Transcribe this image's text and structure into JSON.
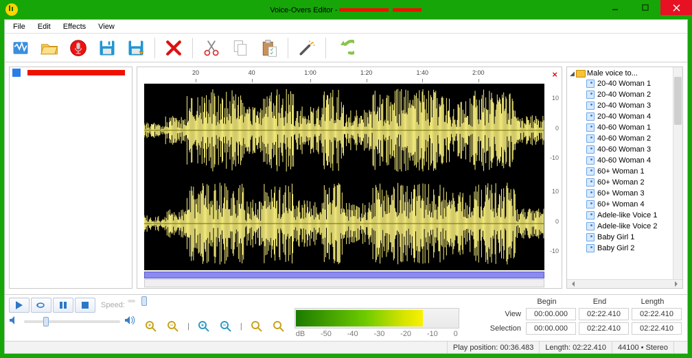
{
  "titlebar": {
    "title_prefix": "Voice-Overs Editor - "
  },
  "menu": {
    "file": "File",
    "edit": "Edit",
    "effects": "Effects",
    "view": "View"
  },
  "ruler": {
    "t0": "20",
    "t1": "40",
    "t2": "1:00",
    "t3": "1:20",
    "t4": "1:40",
    "t5": "2:00"
  },
  "amp": {
    "p10": "10",
    "p0": "0",
    "m10": "-10",
    "p10b": "10",
    "p0b": "0",
    "m10b": "-10"
  },
  "tree": {
    "root": "Male voice to...",
    "items": [
      "20-40 Woman 1",
      "20-40 Woman 2",
      "20-40 Woman 3",
      "20-40 Woman 4",
      "40-60 Woman 1",
      "40-60 Woman 2",
      "40-60 Woman 3",
      "40-60 Woman 4",
      "60+ Woman 1",
      "60+ Woman 2",
      "60+ Woman 3",
      "60+ Woman 4",
      "Adele-like Voice 1",
      "Adele-like Voice 2",
      "Baby Girl 1",
      "Baby Girl 2"
    ]
  },
  "speed_label": "Speed:",
  "meter": {
    "labels": [
      "dB",
      "-50",
      "-40",
      "-30",
      "-20",
      "-10",
      "0"
    ]
  },
  "info": {
    "hdr_begin": "Begin",
    "hdr_end": "End",
    "hdr_length": "Length",
    "view_label": "View",
    "sel_label": "Selection",
    "view_begin": "00:00.000",
    "view_end": "02:22.410",
    "view_len": "02:22.410",
    "sel_begin": "00:00.000",
    "sel_end": "02:22.410",
    "sel_len": "02:22.410"
  },
  "status": {
    "playpos": "Play position: 00:36.483",
    "length": "Length: 02:22.410",
    "rate": "44100",
    "mode": "Stereo"
  }
}
